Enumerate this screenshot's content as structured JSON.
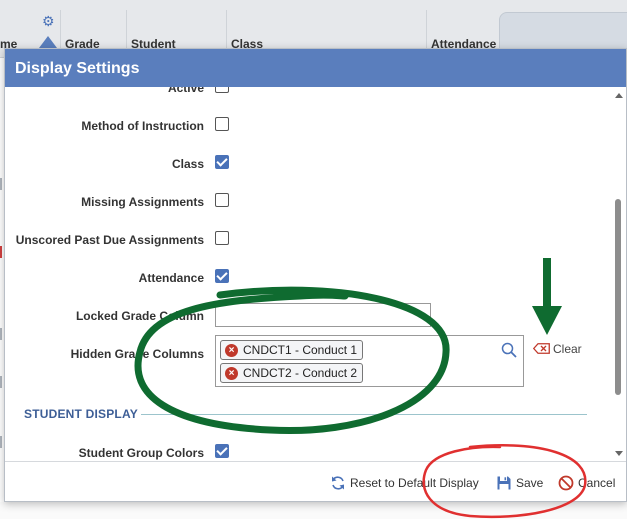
{
  "background": {
    "columns": [
      {
        "label": "me"
      },
      {
        "label": "Grade"
      },
      {
        "label": "Student"
      },
      {
        "label": "Class"
      },
      {
        "label": "Attendance"
      }
    ],
    "gear_icon": "gear-icon"
  },
  "dialog": {
    "title": "Display Settings",
    "settings": [
      {
        "label": "Active",
        "checked": false
      },
      {
        "label": "Method of Instruction",
        "checked": false
      },
      {
        "label": "Class",
        "checked": true
      },
      {
        "label": "Missing Assignments",
        "checked": false
      },
      {
        "label": "Unscored Past Due Assignments",
        "checked": false
      },
      {
        "label": "Attendance",
        "checked": true
      }
    ],
    "locked_grade_column": {
      "label": "Locked Grade Column",
      "value": ""
    },
    "hidden_grade_columns": {
      "label": "Hidden Grade Columns",
      "chips": [
        "CNDCT1 - Conduct 1",
        "CNDCT2 - Conduct 2"
      ],
      "clear_label": "Clear"
    },
    "student_display": {
      "section_title": "STUDENT DISPLAY",
      "student_group_colors": {
        "label": "Student Group Colors",
        "checked": true
      }
    },
    "footer": {
      "reset_label": "Reset to Default Display",
      "save_label": "Save",
      "cancel_label": "Cancel"
    }
  },
  "colors": {
    "title_bar": "#5a7ebd",
    "checkbox_checked": "#4a72b8",
    "annotation_green": "#0f6b30",
    "annotation_red": "#e03030"
  }
}
